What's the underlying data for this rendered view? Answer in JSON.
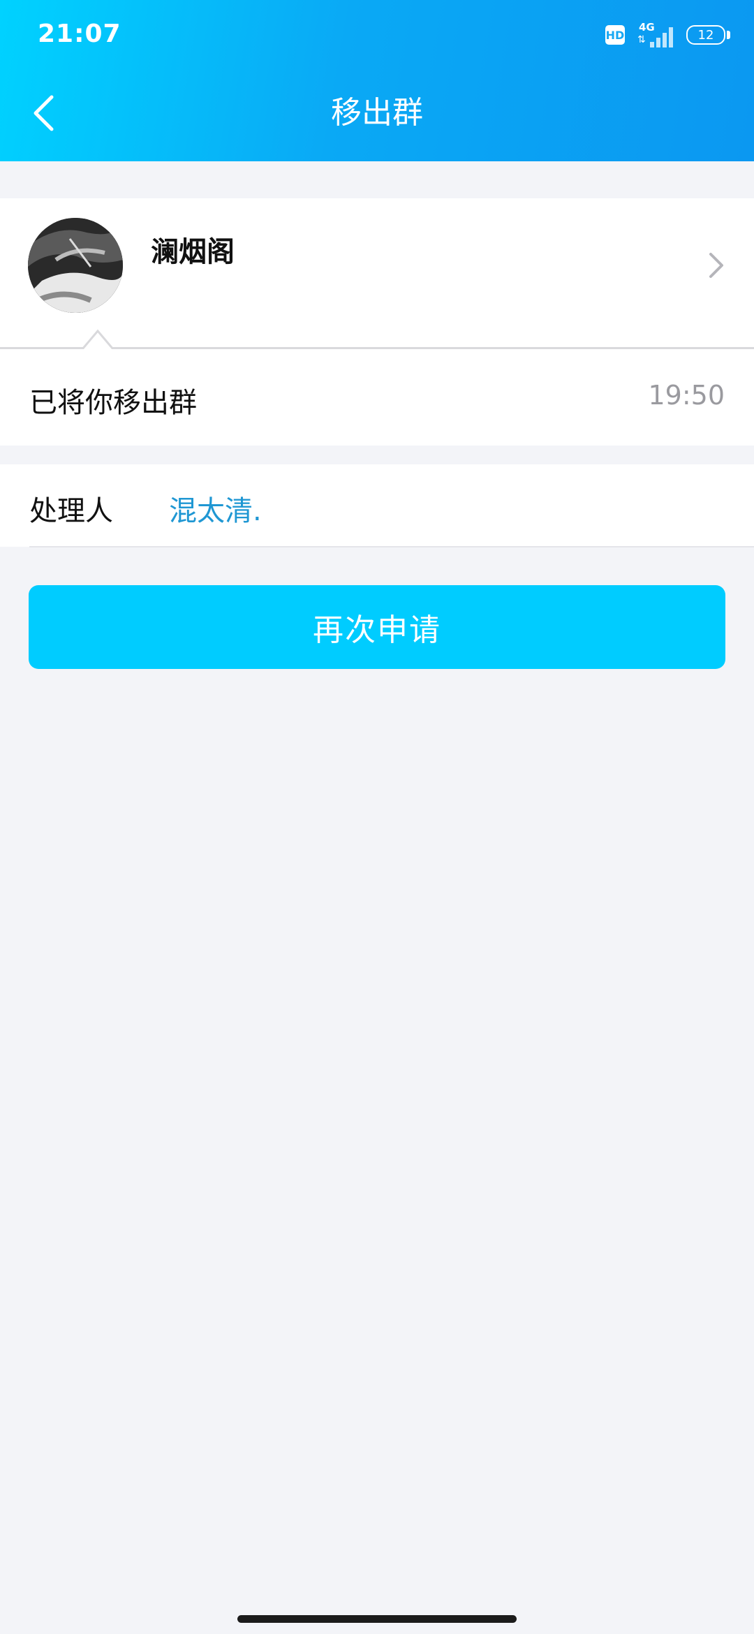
{
  "status_bar": {
    "time": "21:07",
    "hd": "HD",
    "network": "4G",
    "battery": "12"
  },
  "header": {
    "title": "移出群"
  },
  "group": {
    "name": "澜烟阁"
  },
  "message": {
    "text": "已将你移出群",
    "time": "19:50"
  },
  "handler": {
    "label": "处理人",
    "name": "混太清."
  },
  "actions": {
    "reapply_label": "再次申请"
  },
  "colors": {
    "accent": "#00ccff",
    "link": "#1f97d3"
  }
}
